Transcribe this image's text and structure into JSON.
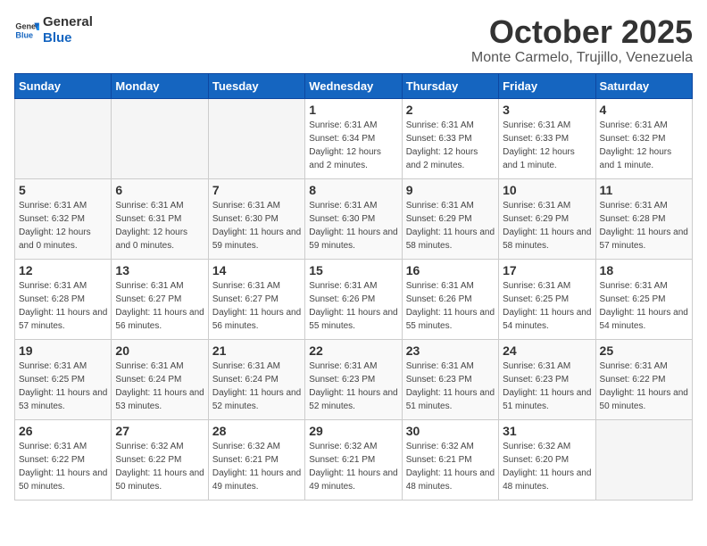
{
  "header": {
    "logo_general": "General",
    "logo_blue": "Blue",
    "title": "October 2025",
    "subtitle": "Monte Carmelo, Trujillo, Venezuela"
  },
  "weekdays": [
    "Sunday",
    "Monday",
    "Tuesday",
    "Wednesday",
    "Thursday",
    "Friday",
    "Saturday"
  ],
  "weeks": [
    [
      {
        "day": "",
        "info": ""
      },
      {
        "day": "",
        "info": ""
      },
      {
        "day": "",
        "info": ""
      },
      {
        "day": "1",
        "info": "Sunrise: 6:31 AM\nSunset: 6:34 PM\nDaylight: 12 hours and 2 minutes."
      },
      {
        "day": "2",
        "info": "Sunrise: 6:31 AM\nSunset: 6:33 PM\nDaylight: 12 hours and 2 minutes."
      },
      {
        "day": "3",
        "info": "Sunrise: 6:31 AM\nSunset: 6:33 PM\nDaylight: 12 hours and 1 minute."
      },
      {
        "day": "4",
        "info": "Sunrise: 6:31 AM\nSunset: 6:32 PM\nDaylight: 12 hours and 1 minute."
      }
    ],
    [
      {
        "day": "5",
        "info": "Sunrise: 6:31 AM\nSunset: 6:32 PM\nDaylight: 12 hours and 0 minutes."
      },
      {
        "day": "6",
        "info": "Sunrise: 6:31 AM\nSunset: 6:31 PM\nDaylight: 12 hours and 0 minutes."
      },
      {
        "day": "7",
        "info": "Sunrise: 6:31 AM\nSunset: 6:30 PM\nDaylight: 11 hours and 59 minutes."
      },
      {
        "day": "8",
        "info": "Sunrise: 6:31 AM\nSunset: 6:30 PM\nDaylight: 11 hours and 59 minutes."
      },
      {
        "day": "9",
        "info": "Sunrise: 6:31 AM\nSunset: 6:29 PM\nDaylight: 11 hours and 58 minutes."
      },
      {
        "day": "10",
        "info": "Sunrise: 6:31 AM\nSunset: 6:29 PM\nDaylight: 11 hours and 58 minutes."
      },
      {
        "day": "11",
        "info": "Sunrise: 6:31 AM\nSunset: 6:28 PM\nDaylight: 11 hours and 57 minutes."
      }
    ],
    [
      {
        "day": "12",
        "info": "Sunrise: 6:31 AM\nSunset: 6:28 PM\nDaylight: 11 hours and 57 minutes."
      },
      {
        "day": "13",
        "info": "Sunrise: 6:31 AM\nSunset: 6:27 PM\nDaylight: 11 hours and 56 minutes."
      },
      {
        "day": "14",
        "info": "Sunrise: 6:31 AM\nSunset: 6:27 PM\nDaylight: 11 hours and 56 minutes."
      },
      {
        "day": "15",
        "info": "Sunrise: 6:31 AM\nSunset: 6:26 PM\nDaylight: 11 hours and 55 minutes."
      },
      {
        "day": "16",
        "info": "Sunrise: 6:31 AM\nSunset: 6:26 PM\nDaylight: 11 hours and 55 minutes."
      },
      {
        "day": "17",
        "info": "Sunrise: 6:31 AM\nSunset: 6:25 PM\nDaylight: 11 hours and 54 minutes."
      },
      {
        "day": "18",
        "info": "Sunrise: 6:31 AM\nSunset: 6:25 PM\nDaylight: 11 hours and 54 minutes."
      }
    ],
    [
      {
        "day": "19",
        "info": "Sunrise: 6:31 AM\nSunset: 6:25 PM\nDaylight: 11 hours and 53 minutes."
      },
      {
        "day": "20",
        "info": "Sunrise: 6:31 AM\nSunset: 6:24 PM\nDaylight: 11 hours and 53 minutes."
      },
      {
        "day": "21",
        "info": "Sunrise: 6:31 AM\nSunset: 6:24 PM\nDaylight: 11 hours and 52 minutes."
      },
      {
        "day": "22",
        "info": "Sunrise: 6:31 AM\nSunset: 6:23 PM\nDaylight: 11 hours and 52 minutes."
      },
      {
        "day": "23",
        "info": "Sunrise: 6:31 AM\nSunset: 6:23 PM\nDaylight: 11 hours and 51 minutes."
      },
      {
        "day": "24",
        "info": "Sunrise: 6:31 AM\nSunset: 6:23 PM\nDaylight: 11 hours and 51 minutes."
      },
      {
        "day": "25",
        "info": "Sunrise: 6:31 AM\nSunset: 6:22 PM\nDaylight: 11 hours and 50 minutes."
      }
    ],
    [
      {
        "day": "26",
        "info": "Sunrise: 6:31 AM\nSunset: 6:22 PM\nDaylight: 11 hours and 50 minutes."
      },
      {
        "day": "27",
        "info": "Sunrise: 6:32 AM\nSunset: 6:22 PM\nDaylight: 11 hours and 50 minutes."
      },
      {
        "day": "28",
        "info": "Sunrise: 6:32 AM\nSunset: 6:21 PM\nDaylight: 11 hours and 49 minutes."
      },
      {
        "day": "29",
        "info": "Sunrise: 6:32 AM\nSunset: 6:21 PM\nDaylight: 11 hours and 49 minutes."
      },
      {
        "day": "30",
        "info": "Sunrise: 6:32 AM\nSunset: 6:21 PM\nDaylight: 11 hours and 48 minutes."
      },
      {
        "day": "31",
        "info": "Sunrise: 6:32 AM\nSunset: 6:20 PM\nDaylight: 11 hours and 48 minutes."
      },
      {
        "day": "",
        "info": ""
      }
    ]
  ]
}
